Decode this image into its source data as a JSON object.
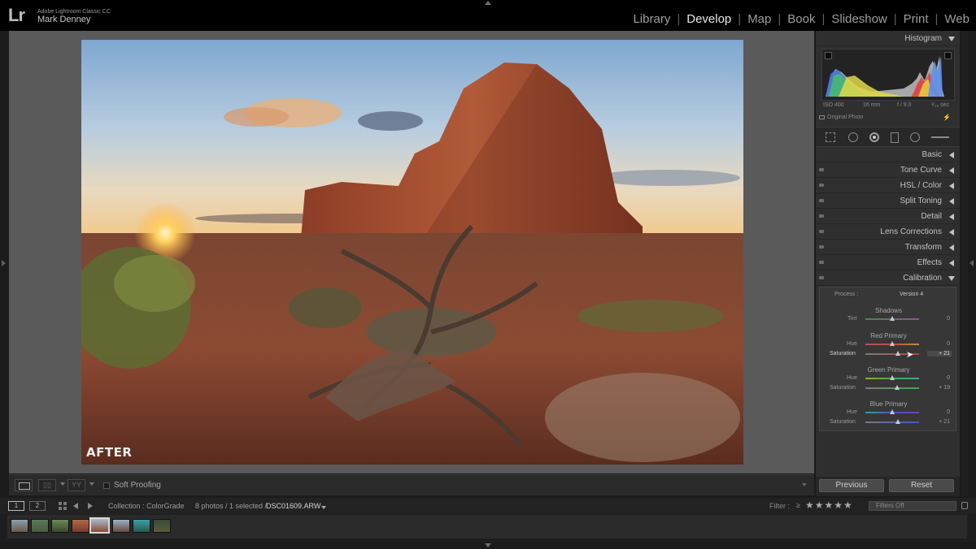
{
  "app": {
    "logo": "Lr",
    "name": "Adobe Lightroom Classic CC",
    "user": "Mark Denney"
  },
  "modules": [
    "Library",
    "Develop",
    "Map",
    "Book",
    "Slideshow",
    "Print",
    "Web"
  ],
  "active_module": "Develop",
  "image": {
    "overlay_label": "AFTER"
  },
  "toolbar": {
    "soft_proofing": "Soft Proofing"
  },
  "panels": {
    "histogram": "Histogram",
    "exif": {
      "iso": "ISO 400",
      "focal": "16 mm",
      "aperture": "f / 9.0",
      "shutter": "¹⁄₂₈ sec"
    },
    "original_photo": "Original Photo",
    "sections": [
      "Basic",
      "Tone Curve",
      "HSL / Color",
      "Split Toning",
      "Detail",
      "Lens Corrections",
      "Transform",
      "Effects",
      "Calibration"
    ]
  },
  "calibration": {
    "process_label": "Process :",
    "process_value": "Version 4",
    "shadows": {
      "title": "Shadows",
      "tint_label": "Tint",
      "tint": "0"
    },
    "red": {
      "title": "Red Primary",
      "hue_label": "Hue",
      "hue": "0",
      "sat_label": "Saturation",
      "sat": "+ 21"
    },
    "green": {
      "title": "Green Primary",
      "hue_label": "Hue",
      "hue": "0",
      "sat_label": "Saturation",
      "sat": "+ 19"
    },
    "blue": {
      "title": "Blue Primary",
      "hue_label": "Hue",
      "hue": "0",
      "sat_label": "Saturation",
      "sat": "+ 21"
    }
  },
  "buttons": {
    "previous": "Previous",
    "reset": "Reset"
  },
  "filmbar": {
    "screen1": "1",
    "screen2": "2",
    "collection": "Collection : ColorGrade",
    "count": "8 photos / 1 selected /",
    "filename": "DSC01609.ARW",
    "filter_label": "Filter :",
    "rating_op": "≥",
    "stars": "★★★★★",
    "filters_off": "Filters Off"
  },
  "colors": {
    "accent": "#c8c8c8",
    "background": "#1b1b1b",
    "center_bg": "#5a5a5a",
    "panel_bg": "#2f2f2f"
  }
}
